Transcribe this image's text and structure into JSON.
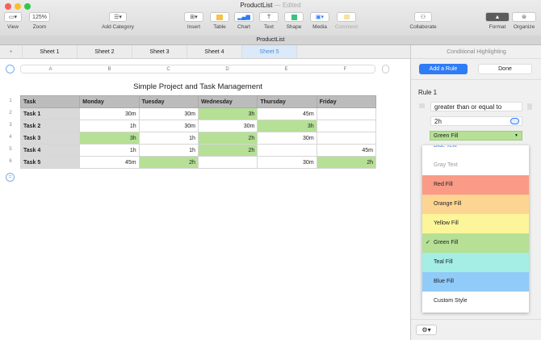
{
  "window": {
    "title": "ProductList",
    "status": "— Edited",
    "doc_name": "ProductList"
  },
  "toolbar": {
    "view": "View",
    "zoom_value": "125%",
    "zoom": "Zoom",
    "add_category": "Add Category",
    "insert": "Insert",
    "table": "Table",
    "chart": "Chart",
    "text": "Text",
    "shape": "Shape",
    "media": "Media",
    "comment": "Comment",
    "collaborate": "Collaborate",
    "format": "Format",
    "organize": "Organize"
  },
  "sheets": [
    "Sheet 1",
    "Sheet 2",
    "Sheet 3",
    "Sheet 4",
    "Sheet 5"
  ],
  "columns": [
    "A",
    "B",
    "C",
    "D",
    "E",
    "F"
  ],
  "table": {
    "title": "Simple Project and Task Management",
    "headers": [
      "Task",
      "Monday",
      "Tuesday",
      "Wednesday",
      "Thursday",
      "Friday"
    ],
    "rows": [
      [
        "Task 1",
        "30m",
        "30m",
        "3h",
        "45m",
        ""
      ],
      [
        "Task 2",
        "1h",
        "30m",
        "30m",
        "3h",
        ""
      ],
      [
        "Task 3",
        "3h",
        "1h",
        "2h",
        "30m",
        ""
      ],
      [
        "Task 4",
        "1h",
        "1h",
        "2h",
        "",
        "45m"
      ],
      [
        "Task 5",
        "45m",
        "2h",
        "",
        "30m",
        "2h"
      ]
    ]
  },
  "panel": {
    "title": "Conditional Highlighting",
    "add_rule": "Add a Rule",
    "done": "Done",
    "rule_label": "Rule 1",
    "condition": "greater than or equal to",
    "value": "2h",
    "style": "Green Fill",
    "options": [
      {
        "label": "Blue Text",
        "bg": "#ffffff",
        "color": "#3a6fd8"
      },
      {
        "label": "Gray Text",
        "bg": "#ffffff",
        "color": "#999999"
      },
      {
        "label": "Red Fill",
        "bg": "#f99b86"
      },
      {
        "label": "Orange Fill",
        "bg": "#fdd592"
      },
      {
        "label": "Yellow Fill",
        "bg": "#fdf59a"
      },
      {
        "label": "Green Fill",
        "bg": "#b5e095",
        "checked": true
      },
      {
        "label": "Teal Fill",
        "bg": "#a4eee6"
      },
      {
        "label": "Blue Fill",
        "bg": "#91cbf9"
      },
      {
        "label": "Custom Style",
        "bg": "#ffffff"
      }
    ]
  },
  "colors": {
    "highlight": "#b5e095",
    "accent": "#2e7cf6"
  }
}
